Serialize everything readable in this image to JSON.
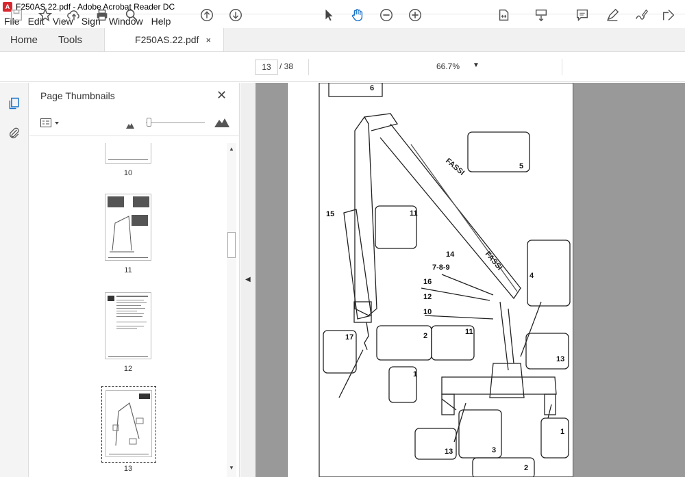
{
  "window": {
    "title": "F250AS.22.pdf - Adobe Acrobat Reader DC"
  },
  "menu": [
    "File",
    "Edit",
    "View",
    "Sign",
    "Window",
    "Help"
  ],
  "tabs": {
    "home": "Home",
    "tools": "Tools",
    "doc": "F250AS.22.pdf",
    "close": "×"
  },
  "toolbar": {
    "page_current": "13",
    "page_total": "/ 38",
    "zoom": "66.7%",
    "zoom_arrow": "▼"
  },
  "panel": {
    "title": "Page Thumbnails",
    "close": "✕",
    "thumbs": [
      {
        "label": "10"
      },
      {
        "label": "11"
      },
      {
        "label": "12"
      },
      {
        "label": "13"
      }
    ]
  },
  "diagram": {
    "labels": [
      "6",
      "5",
      "11",
      "15",
      "14",
      "7-8-9",
      "16",
      "12",
      "10",
      "4",
      "17",
      "2",
      "11",
      "13",
      "1",
      "1",
      "3",
      "13",
      "2"
    ]
  },
  "colors": {
    "accent": "#1a73c9",
    "app_icon": "#d7282f"
  }
}
